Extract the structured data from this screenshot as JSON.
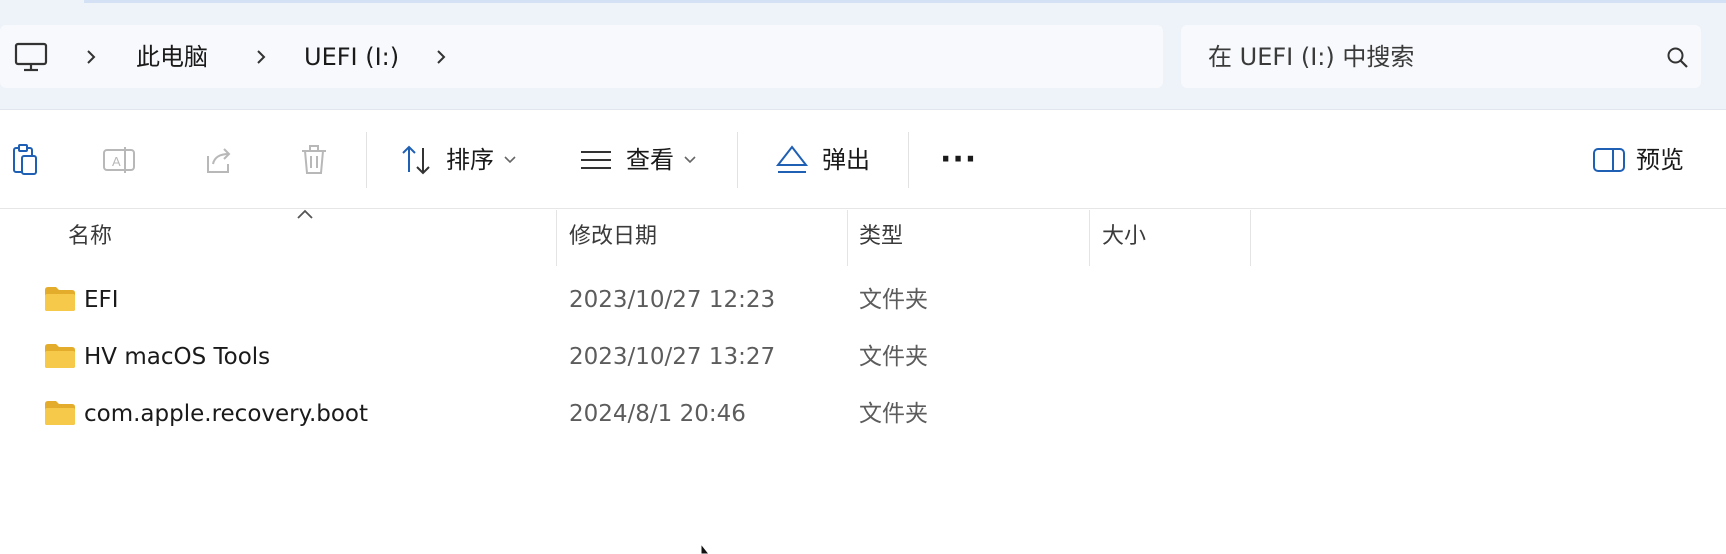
{
  "address": {
    "computer_icon": "monitor-icon",
    "breadcrumb": [
      "此电脑",
      "UEFI (I:)"
    ],
    "separator_icon": "chevron-right-icon"
  },
  "search": {
    "placeholder": "在 UEFI (I:) 中搜索",
    "icon": "search-icon"
  },
  "toolbar": {
    "icons": [
      "paste-icon",
      "rename-icon",
      "share-icon",
      "delete-icon"
    ],
    "sort_label": "排序",
    "view_label": "查看",
    "eject_label": "弹出",
    "more_label": "···",
    "preview_label": "预览"
  },
  "columns": {
    "name": "名称",
    "modified": "修改日期",
    "type": "类型",
    "size": "大小"
  },
  "files": [
    {
      "name": "EFI",
      "modified": "2023/10/27 12:23",
      "type": "文件夹",
      "size": ""
    },
    {
      "name": "HV macOS Tools",
      "modified": "2023/10/27 13:27",
      "type": "文件夹",
      "size": ""
    },
    {
      "name": "com.apple.recovery.boot",
      "modified": "2024/8/1 20:46",
      "type": "文件夹",
      "size": ""
    }
  ],
  "colors": {
    "folder": "#f6c94a",
    "folder_dark": "#e3ac2a",
    "chrome_band": "#eef2f9",
    "icon_blue": "#1f5fb4"
  }
}
